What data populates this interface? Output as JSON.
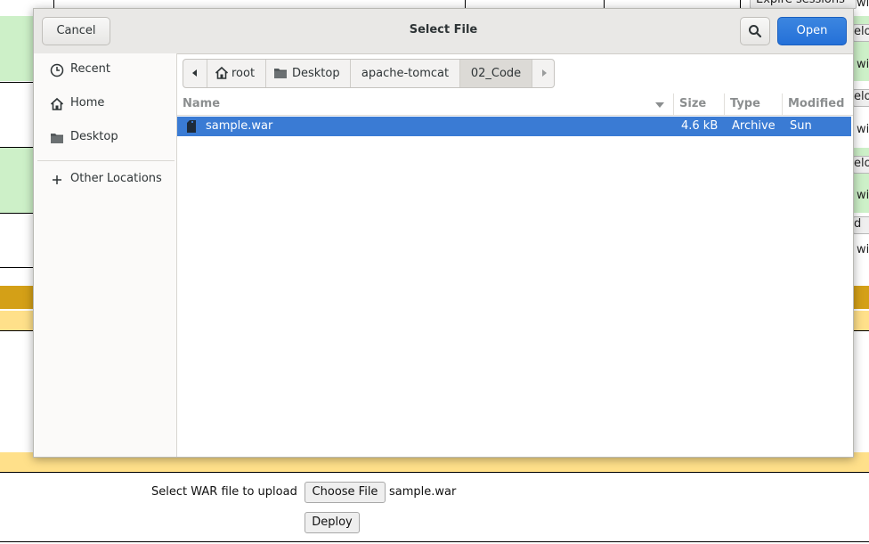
{
  "background_page": {
    "peek_texts": [
      "Expire sessions",
      "wi",
      "elo",
      "wi",
      "elo",
      "wi",
      "elo",
      "wi",
      "d",
      "wi"
    ],
    "upload": {
      "label": "Select WAR file to upload",
      "choose_button": "Choose File",
      "chosen_file": "sample.war",
      "deploy_button": "Deploy"
    },
    "colors": {
      "green": "#cdf0c8",
      "gold": "#d4a017",
      "pale_gold": "#ffe08a"
    }
  },
  "dialog": {
    "title": "Select File",
    "cancel_label": "Cancel",
    "open_label": "Open",
    "search_icon": "search-icon",
    "sidebar": {
      "items": [
        {
          "label": "Recent",
          "icon": "clock-icon"
        },
        {
          "label": "Home",
          "icon": "home-icon"
        },
        {
          "label": "Desktop",
          "icon": "folder-icon"
        },
        {
          "label": "Other Locations",
          "icon": "plus-icon"
        }
      ]
    },
    "pathbar": {
      "crumbs": [
        "root",
        "Desktop",
        "apache-tomcat",
        "02_Code"
      ],
      "active": "02_Code"
    },
    "columns": [
      "Name",
      "Size",
      "Type",
      "Modified"
    ],
    "files": [
      {
        "name": "sample.war",
        "size": "4.6 kB",
        "type": "Archive",
        "modified": "Sun",
        "selected": true
      }
    ],
    "colors": {
      "accent": "#3a7bd4",
      "open_button": "#2a74da"
    }
  }
}
